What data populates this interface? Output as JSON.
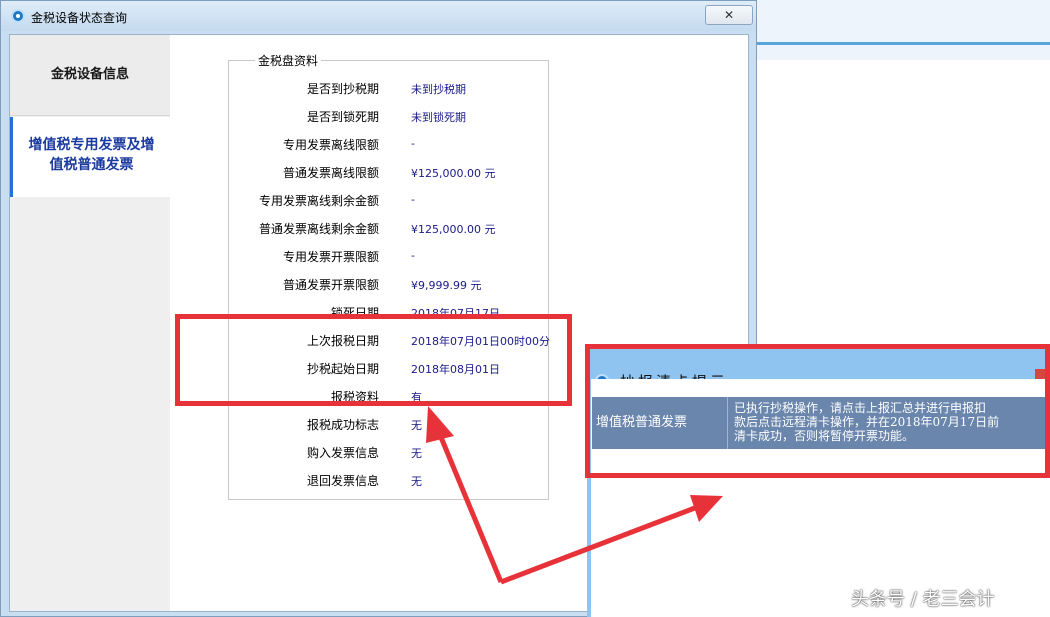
{
  "dialog": {
    "title": "金税设备状态查询",
    "close_label": "✕"
  },
  "nav": {
    "items": [
      {
        "label": "金税设备信息"
      },
      {
        "label_line1": "增值税专用发票及增",
        "label_line2": "值税普通发票"
      }
    ]
  },
  "panel": {
    "group_title": "金税盘资料",
    "rows": [
      {
        "label": "是否到抄税期",
        "value": "未到抄税期"
      },
      {
        "label": "是否到锁死期",
        "value": "未到锁死期"
      },
      {
        "label": "专用发票离线限额",
        "value": "-"
      },
      {
        "label": "普通发票离线限额",
        "value": "¥125,000.00 元"
      },
      {
        "label": "专用发票离线剩余金额",
        "value": "-"
      },
      {
        "label": "普通发票离线剩余金额",
        "value": "¥125,000.00 元"
      },
      {
        "label": "专用发票开票限额",
        "value": "-"
      },
      {
        "label": "普通发票开票限额",
        "value": "¥9,999.99 元"
      },
      {
        "label": "锁死日期",
        "value": "2018年07月17日"
      },
      {
        "label": "上次报税日期",
        "value": "2018年07月01日00时00分"
      },
      {
        "label": "抄税起始日期",
        "value": "2018年08月01日"
      },
      {
        "label": "报税资料",
        "value": "有"
      },
      {
        "label": "报税成功标志",
        "value": "无"
      },
      {
        "label": "购入发票信息",
        "value": "无"
      },
      {
        "label": "退回发票信息",
        "value": "无"
      }
    ]
  },
  "popup": {
    "title": "抄报清卡提示",
    "invoice_type": "增值税普通发票",
    "message_line1": "已执行抄税操作，请点击上报汇总并进行申报扣",
    "message_line2": "款后点击远程清卡操作，并在2018年07月17日前",
    "message_line3": "清卡成功，否则将暂停开票功能。"
  },
  "watermark": "头条号 / 老三会计",
  "colors": {
    "highlight": "#e8323a",
    "nav_active_text": "#1a3aa0",
    "value_text": "#1a1a8c",
    "popup_row": "#6a86ad"
  }
}
